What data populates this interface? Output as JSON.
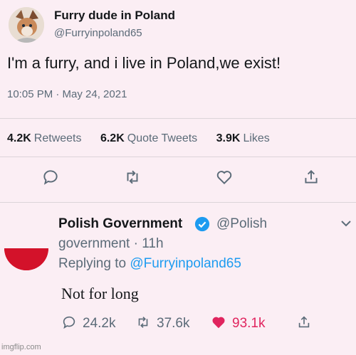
{
  "tweet": {
    "author": {
      "name": "Furry dude in Poland",
      "handle": "@Furryinpoland65"
    },
    "text": "I'm a furry, and i live in Poland,we exist!",
    "timestamp": "10:05 PM · May 24, 2021",
    "stats": {
      "retweets": {
        "value": "4.2K",
        "label": "Retweets"
      },
      "quote_tweets": {
        "value": "6.2K",
        "label": "Quote Tweets"
      },
      "likes": {
        "value": "3.9K",
        "label": "Likes"
      }
    },
    "actions": [
      "comment-icon",
      "retweet-icon",
      "heart-icon",
      "share-icon"
    ]
  },
  "reply": {
    "author": {
      "name": "Polish Government",
      "handle_part1": "@Polish",
      "handle_part2": "government",
      "time": " · 11h"
    },
    "replying_prefix": "Replying to ",
    "replying_mention": "@Furryinpoland65",
    "text": "Not for long",
    "actions": {
      "replies": "24.2k",
      "retweets": "37.6k",
      "likes": "93.1k"
    }
  },
  "watermark": "imgflip.com",
  "colors": {
    "background": "#fbeef4",
    "accent": "#1d9bf0",
    "like_red": "#e0245e",
    "flag_red": "#d3122a"
  }
}
